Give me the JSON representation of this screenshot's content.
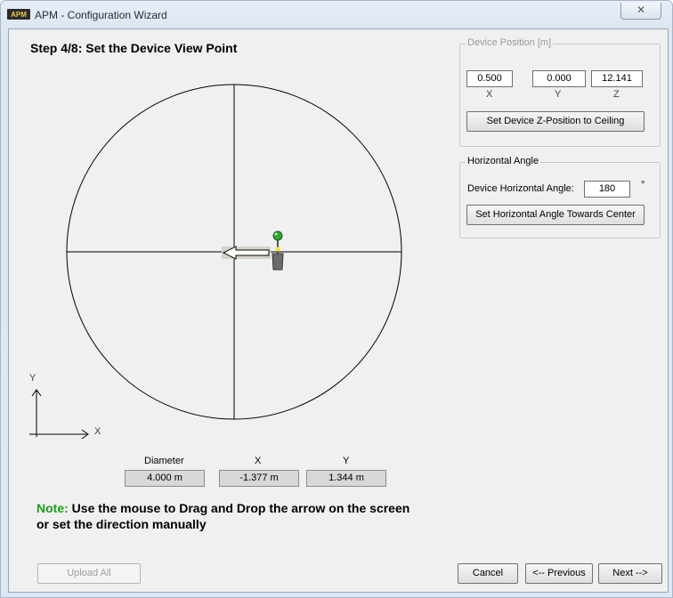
{
  "window": {
    "title": "APM - Configuration Wizard",
    "close_glyph": "✕"
  },
  "step_title": "Step 4/8: Set the Device View Point",
  "device_position": {
    "title": "Device Position [m]",
    "x_value": "0.500",
    "y_value": "0.000",
    "z_value": "12.141",
    "x_label": "X",
    "y_label": "Y",
    "z_label": "Z",
    "set_z_button": "Set Device Z-Position to Ceiling"
  },
  "horizontal_angle": {
    "title": "Horizontal Angle",
    "angle_label": "Device Horizontal Angle:",
    "angle_value": "180",
    "degree_symbol": "°",
    "set_angle_button": "Set Horizontal Angle Towards Center"
  },
  "plot": {
    "axis_y_label": "Y",
    "axis_x_label": "X"
  },
  "readouts": {
    "diameter_label": "Diameter",
    "diameter_value": "4.000 m",
    "x_label": "X",
    "x_value": "-1.377 m",
    "y_label": "Y",
    "y_value": "1.344 m"
  },
  "note": {
    "prefix": "Note:",
    "text": " Use the mouse to Drag and Drop the arrow on the screen or set the direction manually"
  },
  "buttons": {
    "upload_all": "Upload All",
    "cancel": "Cancel",
    "previous": "<-- Previous",
    "next": "Next -->"
  },
  "colors": {
    "note_accent": "#1e9e1e",
    "device_green": "#2fa82f"
  },
  "icons": {
    "app": "apm-logo-icon",
    "device": "camera-device-icon",
    "direction": "direction-arrow-icon"
  }
}
